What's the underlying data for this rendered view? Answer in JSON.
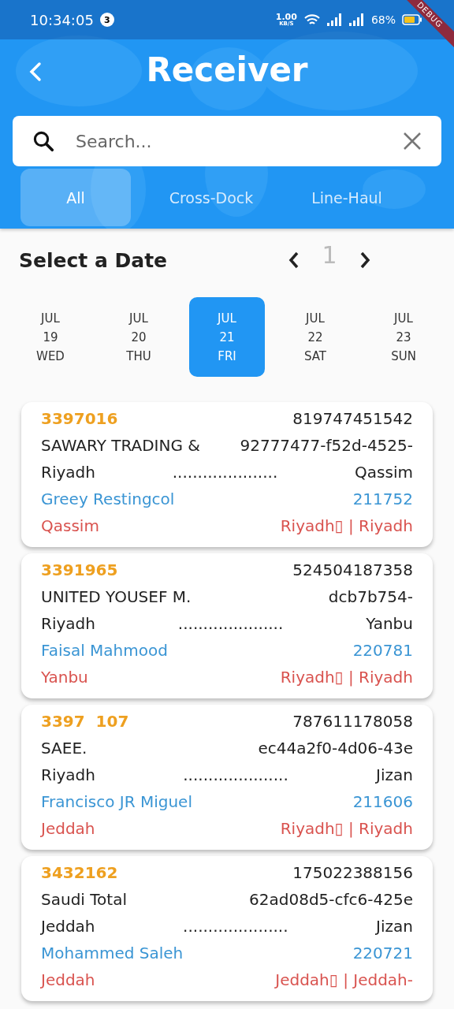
{
  "status_bar": {
    "time": "10:34:05",
    "notification_count": "3",
    "speed": "1.00",
    "speed_unit": "KB/S",
    "battery": "68%"
  },
  "debug_banner": "DEBUG",
  "header": {
    "title": "Receiver"
  },
  "search": {
    "placeholder": "Search..."
  },
  "tabs": [
    {
      "label": "All",
      "selected": true
    },
    {
      "label": "Cross-Dock",
      "selected": false
    },
    {
      "label": "Line-Haul",
      "selected": false
    }
  ],
  "date_picker": {
    "title": "Select a Date",
    "page": "1",
    "days": [
      {
        "month": "JUL",
        "day": "19",
        "weekday": "WED",
        "selected": false
      },
      {
        "month": "JUL",
        "day": "20",
        "weekday": "THU",
        "selected": false
      },
      {
        "month": "JUL",
        "day": "21",
        "weekday": "FRI",
        "selected": true
      },
      {
        "month": "JUL",
        "day": "22",
        "weekday": "SAT",
        "selected": false
      },
      {
        "month": "JUL",
        "day": "23",
        "weekday": "SUN",
        "selected": false
      }
    ]
  },
  "cards": [
    {
      "id": "3397016",
      "number": "819747451542",
      "company": "SAWARY TRADING &",
      "reference": "92777477-f52d-4525-",
      "origin": "Riyadh",
      "separator": ".....................",
      "destination": "Qassim",
      "contact": "Greey Restingcol",
      "code": "211752",
      "region": "Qassim",
      "route": "Riyadh▯ | Riyadh"
    },
    {
      "id": "3391965",
      "number": "524504187358",
      "company": "UNITED YOUSEF M.",
      "reference": "dcb7b754-",
      "origin": "Riyadh",
      "separator": ".....................",
      "destination": "Yanbu",
      "contact": "Faisal Mahmood",
      "code": "220781",
      "region": "Yanbu",
      "route": "Riyadh▯ | Riyadh"
    },
    {
      "id": "3397  107",
      "number": "787611178058",
      "company": "SAEE.",
      "reference": "ec44a2f0-4d06-43e",
      "origin": "Riyadh",
      "separator": ".....................",
      "destination": "Jizan",
      "contact": "Francisco JR Miguel",
      "code": "211606",
      "region": "Jeddah",
      "route": "Riyadh▯ | Riyadh"
    },
    {
      "id": "3432162",
      "number": "175022388156",
      "company": "Saudi Total",
      "reference": "62ad08d5-cfc6-425e",
      "origin": "Jeddah",
      "separator": ".....................",
      "destination": "Jizan",
      "contact": "Mohammed Saleh",
      "code": "220721",
      "region": "Jeddah",
      "route": "Jeddah▯ | Jeddah-"
    }
  ]
}
